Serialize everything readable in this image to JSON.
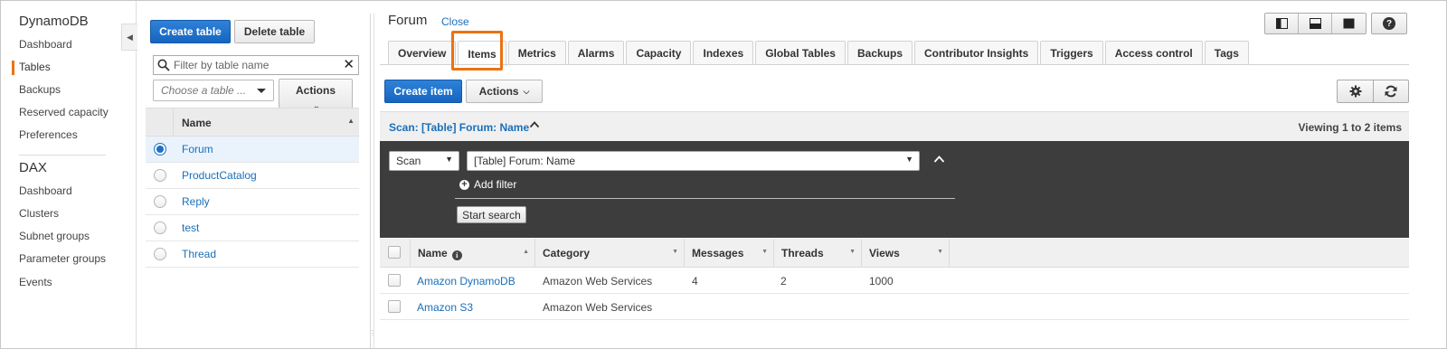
{
  "nav": {
    "dynamodb_heading": "DynamoDB",
    "dynamodb_items": [
      "Dashboard",
      "Tables",
      "Backups",
      "Reserved capacity",
      "Preferences"
    ],
    "active_item": "Tables",
    "dax_heading": "DAX",
    "dax_items": [
      "Dashboard",
      "Clusters",
      "Subnet groups",
      "Parameter groups",
      "Events"
    ]
  },
  "tables_panel": {
    "create_table": "Create table",
    "delete_table": "Delete table",
    "filter_placeholder": "Filter by table name",
    "choose_table_placeholder": "Choose a table ...",
    "actions_label": "Actions",
    "column_name": "Name",
    "tables": [
      {
        "name": "Forum",
        "selected": true
      },
      {
        "name": "ProductCatalog",
        "selected": false
      },
      {
        "name": "Reply",
        "selected": false
      },
      {
        "name": "test",
        "selected": false
      },
      {
        "name": "Thread",
        "selected": false
      }
    ]
  },
  "detail": {
    "title": "Forum",
    "close_label": "Close",
    "tabs": [
      "Overview",
      "Items",
      "Metrics",
      "Alarms",
      "Capacity",
      "Indexes",
      "Global Tables",
      "Backups",
      "Contributor Insights",
      "Triggers",
      "Access control",
      "Tags"
    ],
    "active_tab": "Items",
    "highlight_color": "#ec7211"
  },
  "items": {
    "create_item": "Create item",
    "actions_label": "Actions",
    "scan_summary": "Scan: [Table] Forum: Name",
    "viewing": "Viewing 1 to 2 items",
    "scan_mode": "Scan",
    "scan_target": "[Table] Forum: Name",
    "add_filter": "Add filter",
    "start_search": "Start search",
    "columns": [
      "Name",
      "Category",
      "Messages",
      "Threads",
      "Views"
    ],
    "rows": [
      {
        "name": "Amazon DynamoDB",
        "category": "Amazon Web Services",
        "messages": "4",
        "threads": "2",
        "views": "1000"
      },
      {
        "name": "Amazon S3",
        "category": "Amazon Web Services",
        "messages": "",
        "threads": "",
        "views": ""
      }
    ]
  },
  "icons": {
    "search": "search-icon",
    "clear": "close-icon",
    "collapse": "chevron-left-icon",
    "settings": "gear-icon",
    "refresh": "refresh-icon",
    "help": "help-icon",
    "info": "info-icon"
  },
  "colors": {
    "primary_button": "#1f6fc5",
    "link": "#1a6fb9",
    "scan_panel_bg": "#3d3d3d",
    "active_nav_marker": "#ec7211"
  }
}
